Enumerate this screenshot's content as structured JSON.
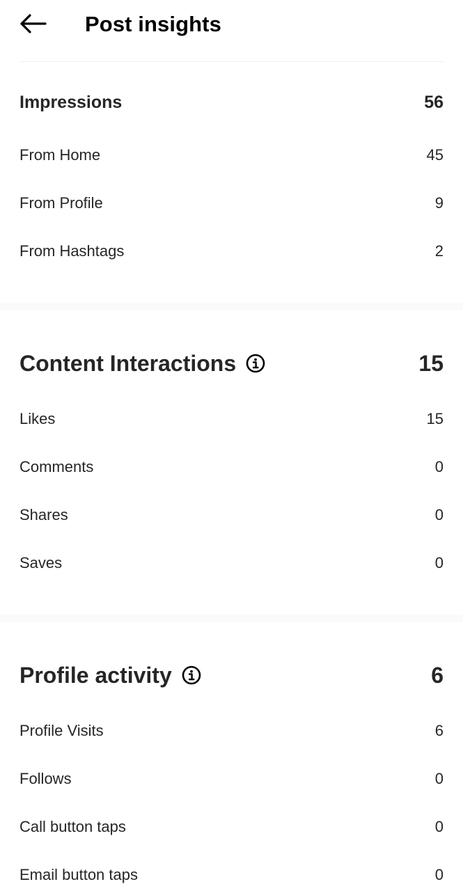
{
  "header": {
    "title": "Post insights",
    "back_icon": "back-arrow-icon"
  },
  "impressions": {
    "label": "Impressions",
    "value": "56",
    "items": [
      {
        "label": "From Home",
        "value": "45"
      },
      {
        "label": "From Profile",
        "value": "9"
      },
      {
        "label": "From Hashtags",
        "value": "2"
      }
    ]
  },
  "content_interactions": {
    "label": "Content Interactions",
    "value": "15",
    "info_icon": "info-icon",
    "items": [
      {
        "label": "Likes",
        "value": "15"
      },
      {
        "label": "Comments",
        "value": "0"
      },
      {
        "label": "Shares",
        "value": "0"
      },
      {
        "label": "Saves",
        "value": "0"
      }
    ]
  },
  "profile_activity": {
    "label": "Profile activity",
    "value": "6",
    "info_icon": "info-icon",
    "items": [
      {
        "label": "Profile Visits",
        "value": "6"
      },
      {
        "label": "Follows",
        "value": "0"
      },
      {
        "label": "Call button taps",
        "value": "0"
      },
      {
        "label": "Email button taps",
        "value": "0"
      }
    ]
  },
  "colors": {
    "text": "#262626",
    "title": "#000000",
    "separator": "#fafafa",
    "divider": "#efefef",
    "background": "#ffffff"
  }
}
